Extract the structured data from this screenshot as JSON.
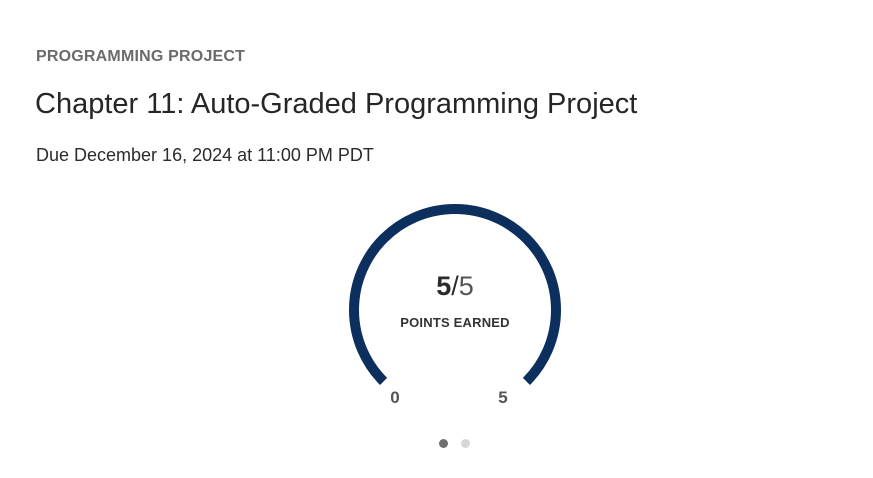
{
  "assignment": {
    "category": "PROGRAMMING PROJECT",
    "title": "Chapter 11: Auto-Graded Programming Project",
    "due": "Due December 16, 2024 at 11:00 PM PDT"
  },
  "score": {
    "earned": "5",
    "separator": "/",
    "total": "5",
    "label": "POINTS EARNED",
    "progress": 1.0,
    "axis_min": "0",
    "axis_max": "5"
  },
  "colors": {
    "gauge_fill": "#0d2f5e",
    "gauge_track": "#e3e7ee",
    "dot_active": "#6f6f6f",
    "dot_inactive": "#d6d6d6"
  },
  "pager": {
    "slides": 2,
    "active": 1
  }
}
